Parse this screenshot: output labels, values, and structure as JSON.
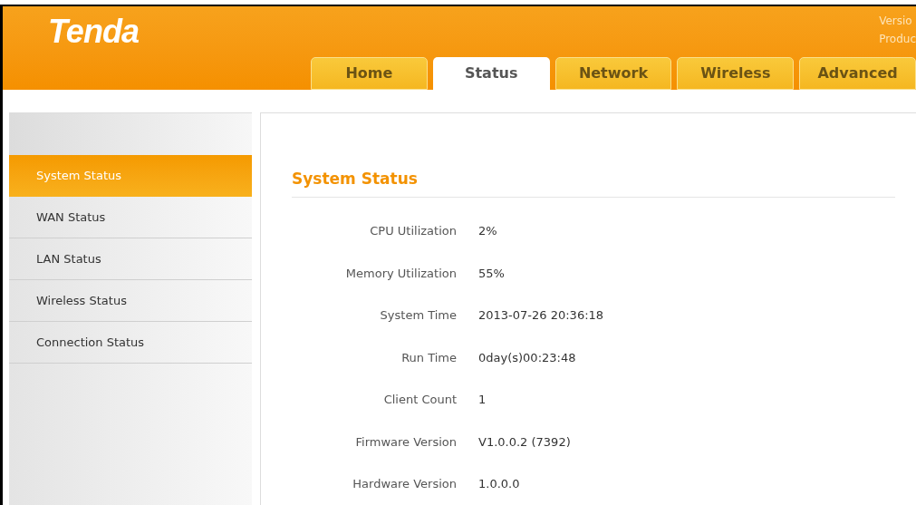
{
  "header": {
    "logo": "Tenda",
    "info_lines": [
      "Versio",
      "Produc"
    ]
  },
  "tabs": [
    {
      "label": "Home",
      "selected": false
    },
    {
      "label": "Status",
      "selected": true
    },
    {
      "label": "Network",
      "selected": false
    },
    {
      "label": "Wireless",
      "selected": false
    },
    {
      "label": "Advanced",
      "selected": false
    }
  ],
  "sidebar": {
    "items": [
      {
        "label": "System Status",
        "selected": true
      },
      {
        "label": "WAN Status",
        "selected": false
      },
      {
        "label": "LAN Status",
        "selected": false
      },
      {
        "label": "Wireless Status",
        "selected": false
      },
      {
        "label": "Connection Status",
        "selected": false
      }
    ]
  },
  "section": {
    "title": "System Status",
    "rows": [
      {
        "label": "CPU Utilization",
        "value": "2%"
      },
      {
        "label": "Memory Utilization",
        "value": "55%"
      },
      {
        "label": "System Time",
        "value": "2013-07-26 20:36:18"
      },
      {
        "label": "Run Time",
        "value": "0day(s)00:23:48"
      },
      {
        "label": "Client Count",
        "value": "1"
      },
      {
        "label": "Firmware Version",
        "value": "V1.0.0.2 (7392)"
      },
      {
        "label": "Hardware Version",
        "value": "1.0.0.0"
      }
    ]
  }
}
